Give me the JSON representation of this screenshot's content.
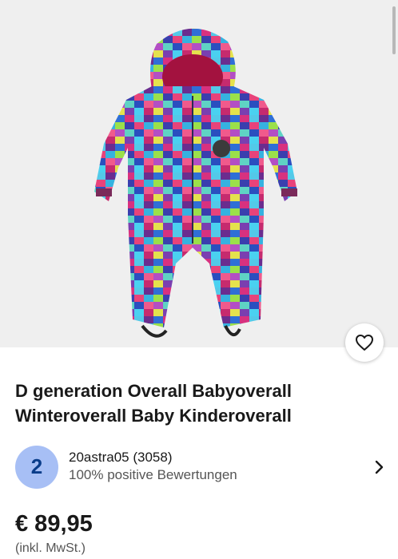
{
  "product": {
    "image_alt": "Baby winter overall with colorful pixel pattern",
    "title": "D generation Overall Babyoverall Winteroverall Baby Kinderoverall",
    "price": "€ 89,95",
    "tax_note": "(inkl. MwSt.)"
  },
  "seller": {
    "badge": "2",
    "name": "20astra05 (3058)",
    "feedback": "100% positive Bewertungen"
  },
  "icons": {
    "favorite": "heart-outline-icon",
    "seller_link": "chevron-right-icon"
  },
  "colors": {
    "badge_bg": "#a7bff5",
    "badge_text": "#0a3d8a",
    "photo_bg": "#efefef"
  }
}
